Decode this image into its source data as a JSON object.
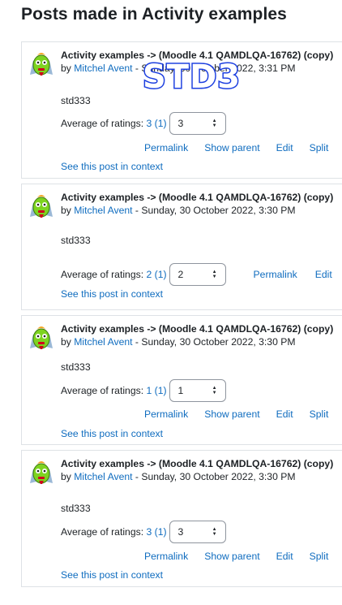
{
  "page": {
    "title": "Posts made in Activity examples"
  },
  "watermark": "STD3",
  "avatar_icon": "green-monster-avatar-icon",
  "colors": {
    "link": "#0f6cbf",
    "watermark": "#1c3fe0",
    "border": "#dee2e6"
  },
  "labels": {
    "by": "by",
    "average_of_ratings": "Average of ratings:",
    "see_in_context": "See this post in context",
    "permalink": "Permalink",
    "show_parent": "Show parent",
    "edit": "Edit",
    "split": "Split"
  },
  "posts": [
    {
      "subject": "Activity examples -> (Moodle 4.1 QAMDLQA-16762) (copy)",
      "author": "Mitchel Avent",
      "date": " - Sunday, 30 October 2022, 3:31 PM",
      "body": "std333",
      "rating_link": "3 (1)",
      "rating_value": "3"
    },
    {
      "subject": "Activity examples -> (Moodle 4.1 QAMDLQA-16762) (copy)",
      "author": "Mitchel Avent",
      "date": " - Sunday, 30 October 2022, 3:30 PM",
      "body": "std333",
      "rating_link": "2 (1)",
      "rating_value": "2"
    },
    {
      "subject": "Activity examples -> (Moodle 4.1 QAMDLQA-16762) (copy)",
      "author": "Mitchel Avent",
      "date": " - Sunday, 30 October 2022, 3:30 PM",
      "body": "std333",
      "rating_link": "1 (1)",
      "rating_value": "1"
    },
    {
      "subject": "Activity examples -> (Moodle 4.1 QAMDLQA-16762) (copy)",
      "author": "Mitchel Avent",
      "date": " - Sunday, 30 October 2022, 3:30 PM",
      "body": "std333",
      "rating_link": "3 (1)",
      "rating_value": "3"
    }
  ]
}
